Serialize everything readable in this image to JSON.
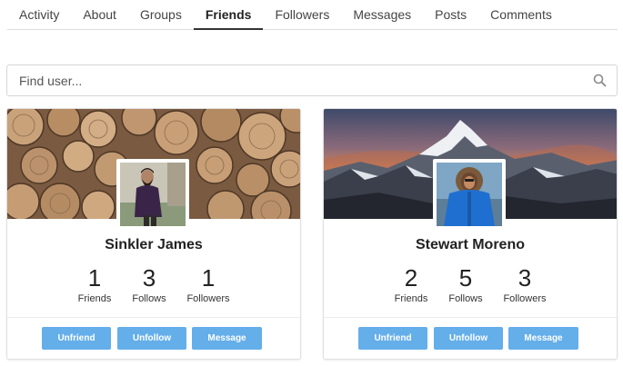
{
  "tabs": [
    {
      "label": "Activity"
    },
    {
      "label": "About"
    },
    {
      "label": "Groups"
    },
    {
      "label": "Friends",
      "active": true
    },
    {
      "label": "Followers"
    },
    {
      "label": "Messages"
    },
    {
      "label": "Posts"
    },
    {
      "label": "Comments"
    }
  ],
  "search": {
    "placeholder": "Find user...",
    "value": "",
    "icon": "search-icon"
  },
  "friends": [
    {
      "name": "Sinkler James",
      "cover": "wood-logs-cover",
      "stats": {
        "friends": "1",
        "follows": "3",
        "followers": "1"
      }
    },
    {
      "name": "Stewart Moreno",
      "cover": "mountain-sunset-cover",
      "stats": {
        "friends": "2",
        "follows": "5",
        "followers": "3"
      }
    }
  ],
  "labels": {
    "friends": "Friends",
    "follows": "Follows",
    "followers": "Followers"
  },
  "buttons": {
    "unfriend": "Unfriend",
    "unfollow": "Unfollow",
    "message": "Message"
  },
  "colors": {
    "accent": "#64aeea",
    "active_tab_underline": "#333333"
  }
}
